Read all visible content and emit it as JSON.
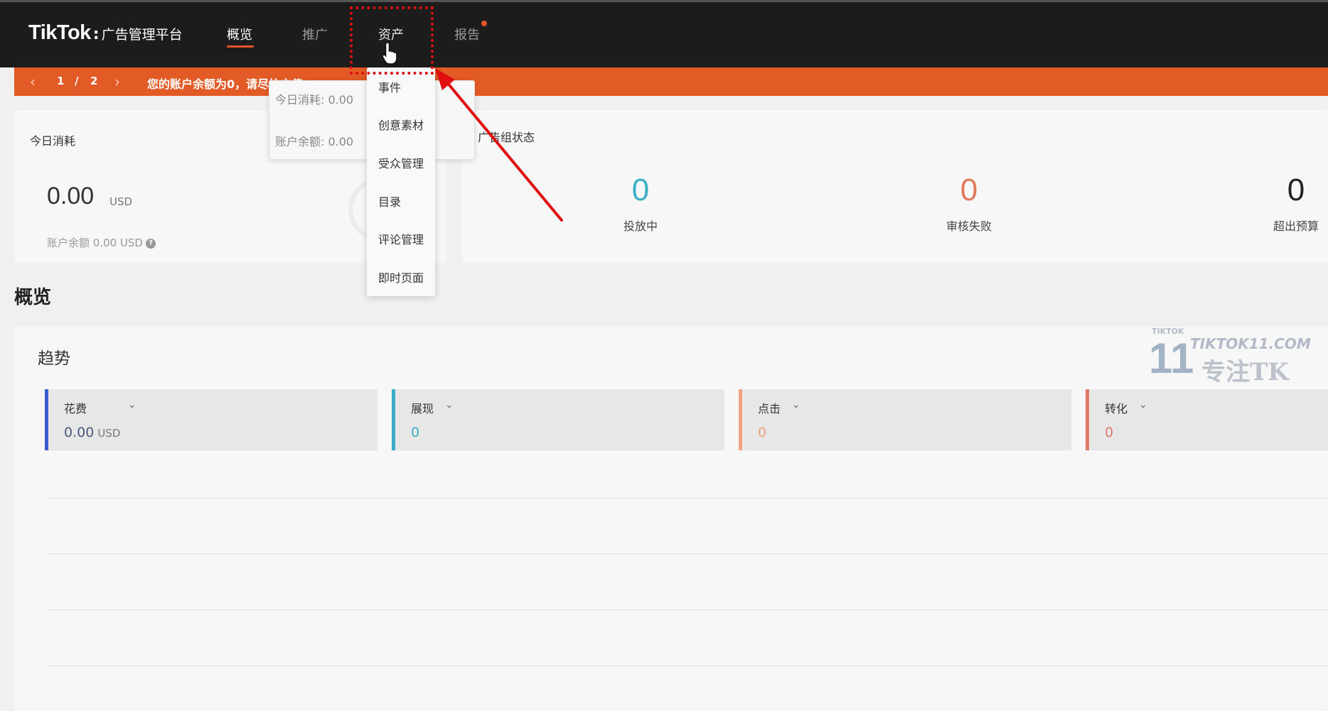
{
  "header": {
    "brand": "TikTok",
    "brand_sep": ":",
    "brand_sub": "广告管理平台",
    "nav": [
      {
        "label": "概览",
        "active": true
      },
      {
        "label": "推广",
        "active": false
      },
      {
        "label": "资产",
        "active": false
      },
      {
        "label": "报告",
        "active": false,
        "badge": true
      }
    ]
  },
  "banner": {
    "prev_icon": "chevron-left-icon",
    "page_current": "1",
    "page_sep": "/",
    "page_total": "2",
    "next_icon": "chevron-right-icon",
    "message": "您的账户余额为0，请尽快充值"
  },
  "tooltip": {
    "today_spend": "今日消耗: 0.00",
    "balance": "账户余额: 0.00"
  },
  "asset_menu": {
    "items": [
      "事件",
      "创意素材",
      "受众管理",
      "目录",
      "评论管理",
      "即时页面"
    ]
  },
  "spend_card": {
    "title": "今日消耗",
    "value": "0.00",
    "unit": "USD",
    "balance": "账户余额 0.00 USD"
  },
  "adgroup_card": {
    "title": "广告组状态",
    "stats": [
      {
        "value": "0",
        "label": "投放中",
        "color": "#3aaec4"
      },
      {
        "value": "0",
        "label": "审核失败",
        "color": "#e07a5a"
      },
      {
        "value": "0",
        "label": "超出预算",
        "color": "#222222"
      }
    ]
  },
  "overview": {
    "title": "概览",
    "trend_title": "趋势",
    "metrics": [
      {
        "label": "花费",
        "value": "0.00",
        "unit": "USD",
        "color": "#3b5bd0",
        "value_color": "#4a5a7a"
      },
      {
        "label": "展现",
        "value": "0",
        "unit": "",
        "color": "#3aaec4",
        "value_color": "#3aaec4"
      },
      {
        "label": "点击",
        "value": "0",
        "unit": "",
        "color": "#f0a383",
        "value_color": "#f0a383"
      },
      {
        "label": "转化",
        "value": "0",
        "unit": "",
        "color": "#e07a6a",
        "value_color": "#e07a6a"
      }
    ]
  },
  "watermark": {
    "small": "TIKTOK",
    "num": "11",
    "site": "TIKTOK11.COM",
    "cn": "专注TK"
  },
  "colors": {
    "accent": "#e8542a",
    "annotation": "#e01010"
  }
}
